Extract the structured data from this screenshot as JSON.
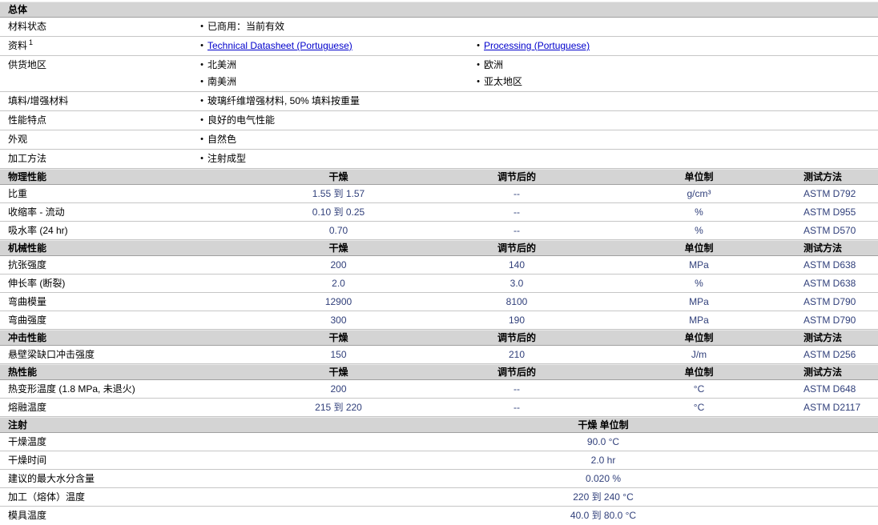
{
  "colors": {
    "header_bg": "#d4d4d4",
    "value_text": "#31407b",
    "link": "#0000cc",
    "row_border": "#c6c6c6"
  },
  "columns": {
    "dry": "干燥",
    "conditioned": "调节后的",
    "units": "单位制",
    "test_method": "测试方法"
  },
  "general": {
    "title": "总体",
    "rows": [
      {
        "label": "材料状态",
        "sup": "",
        "items_left": [
          {
            "text": "已商用：当前有效",
            "link": false
          }
        ],
        "items_right": []
      },
      {
        "label": "资料",
        "sup": "1",
        "items_left": [
          {
            "text": "Technical Datasheet (Portuguese)",
            "link": true
          }
        ],
        "items_right": [
          {
            "text": "Processing (Portuguese)",
            "link": true
          }
        ]
      },
      {
        "label": "供货地区",
        "sup": "",
        "items_left": [
          {
            "text": "北美洲",
            "link": false
          },
          {
            "text": "南美洲",
            "link": false
          }
        ],
        "items_right": [
          {
            "text": "欧洲",
            "link": false
          },
          {
            "text": "亚太地区",
            "link": false
          }
        ]
      },
      {
        "label": "填料/增强材料",
        "sup": "",
        "items_left": [
          {
            "text": "玻璃纤维增强材料, 50% 填料按重量",
            "link": false
          }
        ],
        "items_right": []
      },
      {
        "label": "性能特点",
        "sup": "",
        "items_left": [
          {
            "text": "良好的电气性能",
            "link": false
          }
        ],
        "items_right": []
      },
      {
        "label": "外观",
        "sup": "",
        "items_left": [
          {
            "text": "自然色",
            "link": false
          }
        ],
        "items_right": []
      },
      {
        "label": "加工方法",
        "sup": "",
        "items_left": [
          {
            "text": "注射成型",
            "link": false
          }
        ],
        "items_right": []
      }
    ]
  },
  "property_sections": [
    {
      "title": "物理性能",
      "rows": [
        {
          "name": "比重",
          "dry": "1.55 到  1.57",
          "conditioned": "--",
          "unit": "g/cm³",
          "method": "ASTM D792"
        },
        {
          "name": "收缩率 - 流动",
          "dry": "0.10 到  0.25",
          "conditioned": "--",
          "unit": "%",
          "method": "ASTM D955"
        },
        {
          "name": "吸水率  (24 hr)",
          "dry": "0.70",
          "conditioned": "--",
          "unit": "%",
          "method": "ASTM D570"
        }
      ]
    },
    {
      "title": "机械性能",
      "rows": [
        {
          "name": "抗张强度",
          "dry": "200",
          "conditioned": "140",
          "unit": "MPa",
          "method": "ASTM D638"
        },
        {
          "name": "伸长率  (断裂)",
          "dry": "2.0",
          "conditioned": "3.0",
          "unit": "%",
          "method": "ASTM D638"
        },
        {
          "name": "弯曲模量",
          "dry": "12900",
          "conditioned": "8100",
          "unit": "MPa",
          "method": "ASTM D790"
        },
        {
          "name": "弯曲强度",
          "dry": "300",
          "conditioned": "190",
          "unit": "MPa",
          "method": "ASTM D790"
        }
      ]
    },
    {
      "title": "冲击性能",
      "rows": [
        {
          "name": "悬壁梁缺口冲击强度",
          "dry": "150",
          "conditioned": "210",
          "unit": "J/m",
          "method": "ASTM D256"
        }
      ]
    },
    {
      "title": "热性能",
      "rows": [
        {
          "name": "热变形温度  (1.8 MPa, 未退火)",
          "dry": "200",
          "conditioned": "--",
          "unit": "°C",
          "method": "ASTM D648"
        },
        {
          "name": "熔融温度",
          "dry": "215 到  220",
          "conditioned": "--",
          "unit": "°C",
          "method": "ASTM D2117"
        }
      ]
    }
  ],
  "injection": {
    "title": "注射",
    "column_header": "干燥  单位制",
    "rows": [
      {
        "name": "干燥温度",
        "value": "90.0",
        "unit": "°C"
      },
      {
        "name": "干燥时间",
        "value": "2.0",
        "unit": "hr"
      },
      {
        "name": "建议的最大水分含量",
        "value": "0.020",
        "unit": "%"
      },
      {
        "name": "加工（熔体）温度",
        "value": "220 到  240",
        "unit": "°C"
      },
      {
        "name": "模具温度",
        "value": "40.0 到  80.0",
        "unit": "°C"
      }
    ]
  }
}
